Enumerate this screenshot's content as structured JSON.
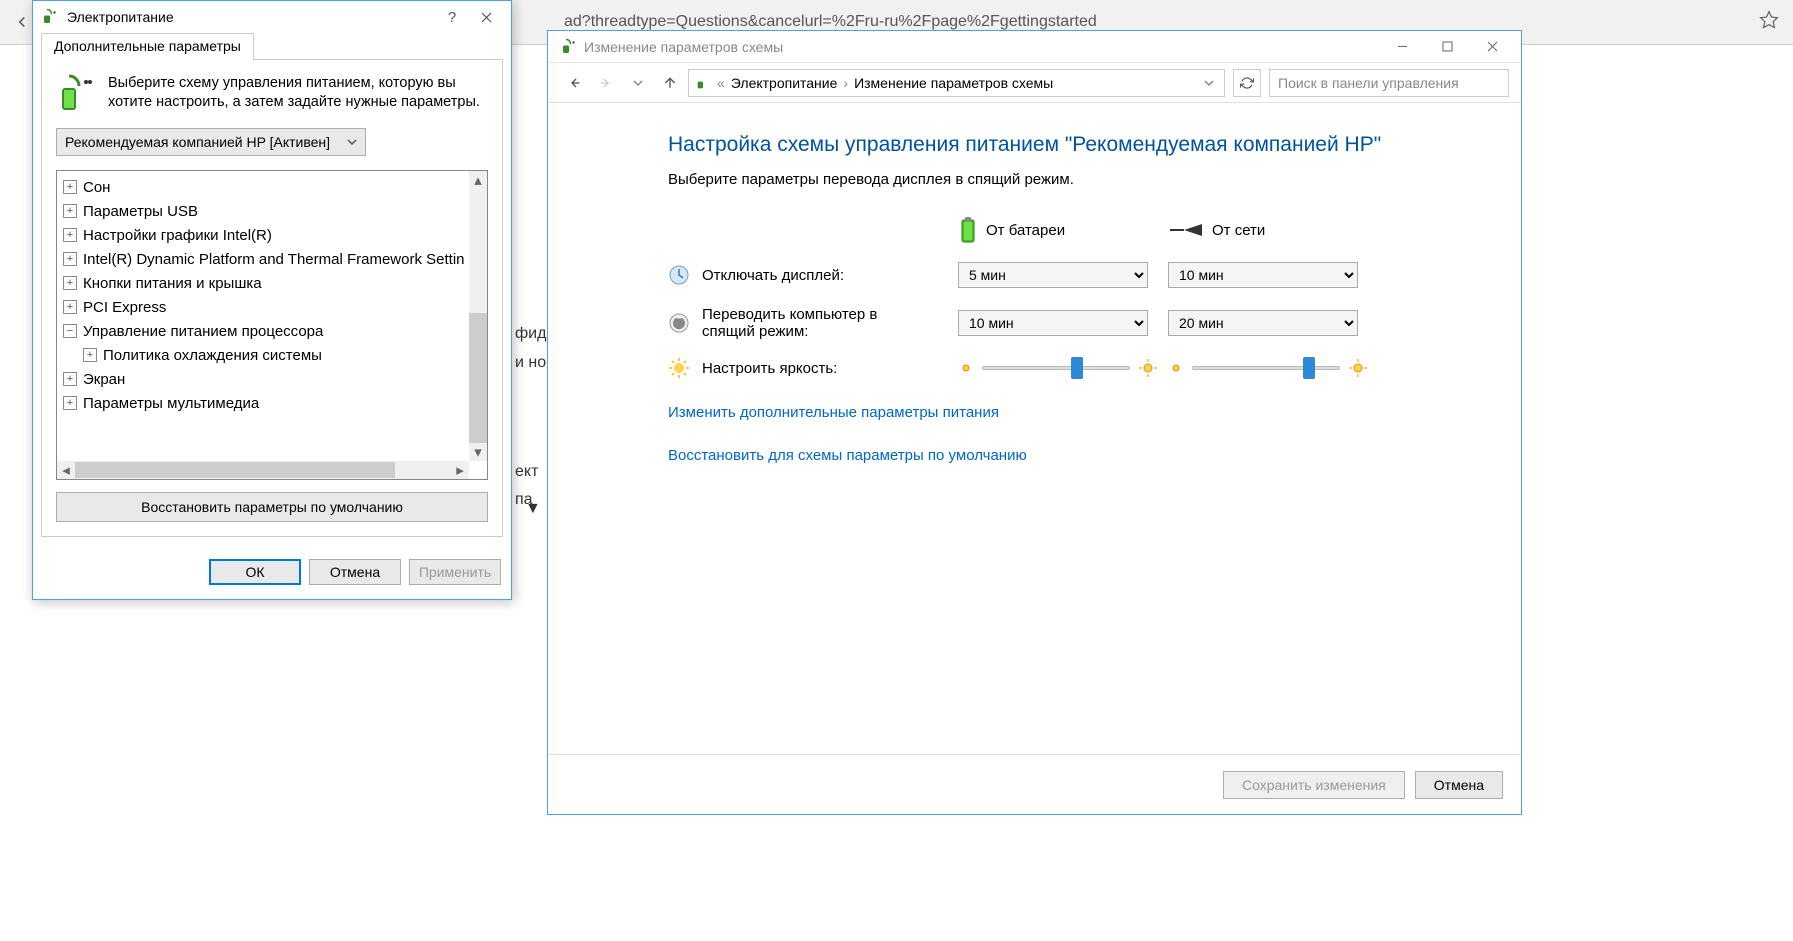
{
  "browser": {
    "url_fragment": "ad?threadtype=Questions&cancelurl=%2Fru-ru%2Fpage%2Fgettingstarted"
  },
  "bg": {
    "t1": "фид",
    "t2": "и но",
    "t3": "ект",
    "t4": "па"
  },
  "cp": {
    "window_title": "Изменение параметров схемы",
    "breadcrumb": {
      "a": "Электропитание",
      "b": "Изменение параметров схемы"
    },
    "search_placeholder": "Поиск в панели управления",
    "h1": "Настройка схемы управления питанием \"Рекомендуемая компанией HP\"",
    "sub": "Выберите параметры перевода дисплея в спящий режим.",
    "col_battery": "От батареи",
    "col_ac": "От сети",
    "row_display": "Отключать дисплей:",
    "row_sleep": "Переводить компьютер в спящий режим:",
    "row_brightness": "Настроить яркость:",
    "display_batt": "5 мин",
    "display_ac": "10 мин",
    "sleep_batt": "10 мин",
    "sleep_ac": "20 мин",
    "link_advanced": "Изменить дополнительные параметры питания",
    "link_restore": "Восстановить для схемы параметры по умолчанию",
    "btn_save": "Сохранить изменения",
    "btn_cancel": "Отмена"
  },
  "adv": {
    "title": "Электропитание",
    "tab": "Дополнительные параметры",
    "intro": "Выберите схему управления питанием, которую вы хотите настроить, а затем задайте нужные параметры.",
    "plan": "Рекомендуемая компанией HP [Активен]",
    "tree": {
      "sleep": "Сон",
      "usb": "Параметры USB",
      "intel_gfx": "Настройки графики Intel(R)",
      "dptf": "Intel(R) Dynamic Platform and Thermal Framework Settin",
      "buttons": "Кнопки питания и крышка",
      "pcie": "PCI Express",
      "cpu": "Управление питанием процессора",
      "cooling": "Политика охлаждения системы",
      "display": "Экран",
      "multimedia": "Параметры мультимедиа"
    },
    "restore": "Восстановить параметры по умолчанию",
    "ok": "ОК",
    "cancel": "Отмена",
    "apply": "Применить"
  }
}
